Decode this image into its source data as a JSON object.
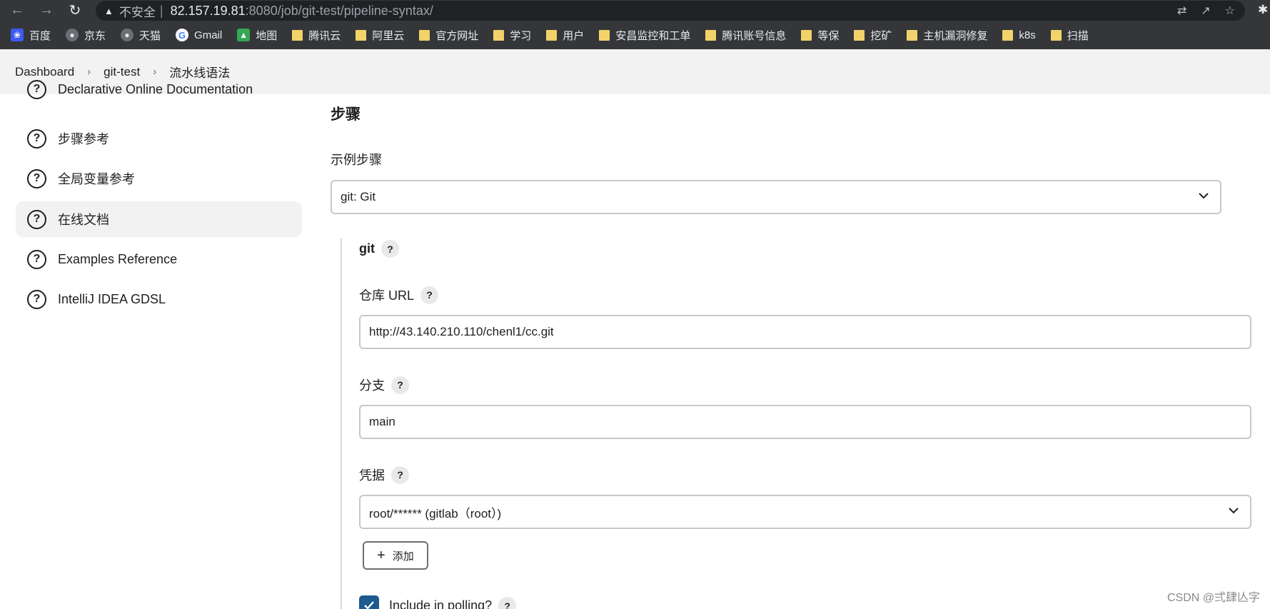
{
  "browser": {
    "insecure_label": "不安全",
    "url_host": "82.157.19.81",
    "url_rest": ":8080/job/git-test/pipeline-syntax/"
  },
  "bookmarks": [
    {
      "label": "百度",
      "icon": "baidu"
    },
    {
      "label": "京东",
      "icon": "globe"
    },
    {
      "label": "天猫",
      "icon": "globe"
    },
    {
      "label": "Gmail",
      "icon": "google"
    },
    {
      "label": "地图",
      "icon": "maps"
    },
    {
      "label": "腾讯云",
      "icon": "folder"
    },
    {
      "label": "阿里云",
      "icon": "folder"
    },
    {
      "label": "官方网址",
      "icon": "folder"
    },
    {
      "label": "学习",
      "icon": "folder"
    },
    {
      "label": "用户",
      "icon": "folder"
    },
    {
      "label": "安昌监控和工单",
      "icon": "folder"
    },
    {
      "label": "腾讯账号信息",
      "icon": "folder"
    },
    {
      "label": "等保",
      "icon": "folder"
    },
    {
      "label": "挖矿",
      "icon": "folder"
    },
    {
      "label": "主机漏洞修复",
      "icon": "folder"
    },
    {
      "label": "k8s",
      "icon": "folder"
    },
    {
      "label": "扫描",
      "icon": "folder"
    }
  ],
  "breadcrumb": {
    "items": [
      "Dashboard",
      "git-test",
      "流水线语法"
    ]
  },
  "sidebar": {
    "items": [
      {
        "label": "Declarative Online Documentation",
        "active": false
      },
      {
        "label": "步骤参考",
        "active": false
      },
      {
        "label": "全局变量参考",
        "active": false
      },
      {
        "label": "在线文档",
        "active": true
      },
      {
        "label": "Examples Reference",
        "active": false
      },
      {
        "label": "IntelliJ IDEA GDSL",
        "active": false
      }
    ]
  },
  "main": {
    "section_title": "步骤",
    "sample_step_label": "示例步骤",
    "sample_step_value": "git: Git",
    "git_title": "git",
    "repo_url_label": "仓库 URL",
    "repo_url_value": "http://43.140.210.110/chenl1/cc.git",
    "branch_label": "分支",
    "branch_value": "main",
    "credentials_label": "凭据",
    "credentials_value": "root/****** (gitlab（root）)",
    "add_button_label": "添加",
    "include_polling_label": "Include in polling?",
    "include_polling_checked": true
  },
  "watermark": "CSDN @弍肆亾字"
}
